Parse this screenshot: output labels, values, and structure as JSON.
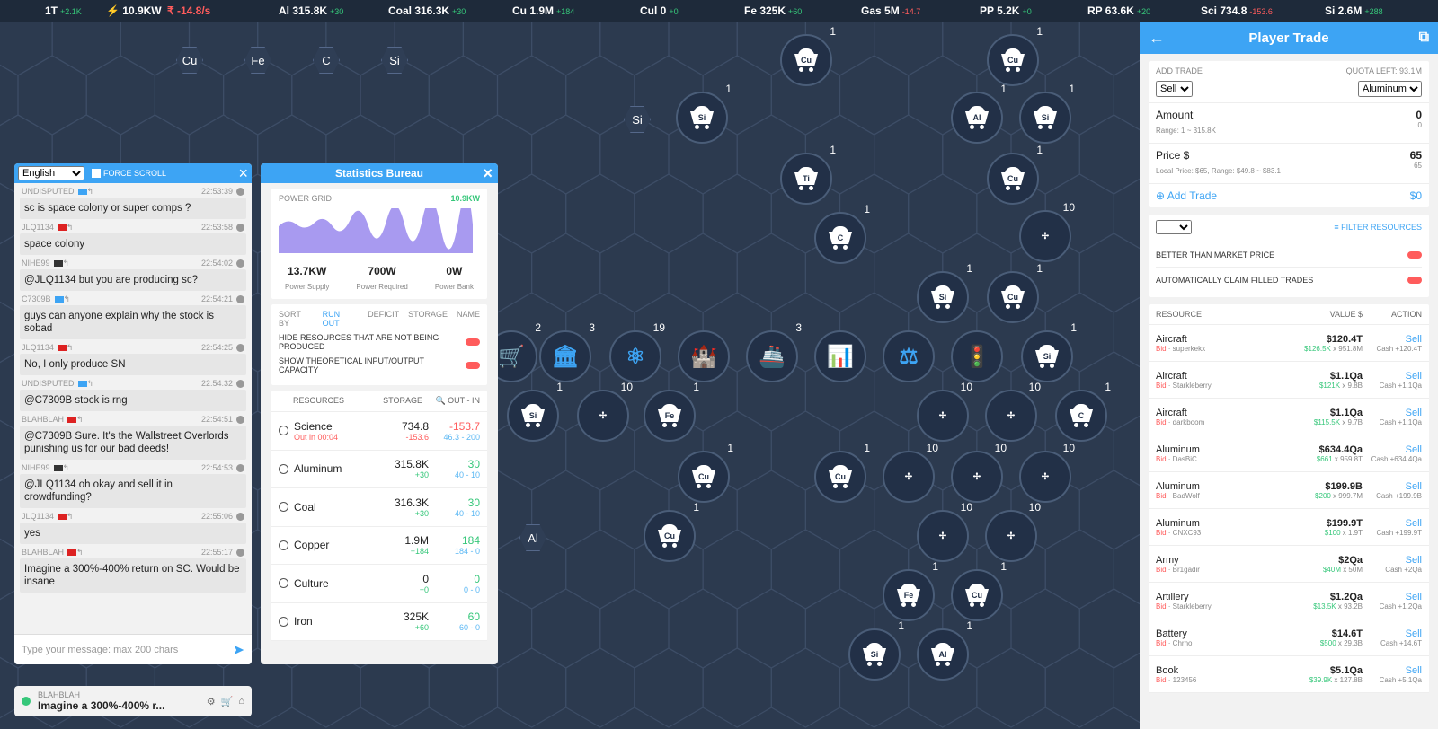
{
  "topbar": [
    {
      "label": "1T",
      "delta": "+2.1K",
      "cls": "up"
    },
    {
      "label": "⚡ 10.9KW",
      "delta": "",
      "cls": "up"
    },
    {
      "label": "₹ -14.8/s",
      "delta": "",
      "cls": "dn"
    },
    {
      "label": "Al 315.8K",
      "delta": "+30",
      "cls": "up"
    },
    {
      "label": "Coal 316.3K",
      "delta": "+30",
      "cls": "up"
    },
    {
      "label": "Cu 1.9M",
      "delta": "+184",
      "cls": "up"
    },
    {
      "label": "Cul 0",
      "delta": "+0",
      "cls": "zr"
    },
    {
      "label": "Fe 325K",
      "delta": "+60",
      "cls": "up"
    },
    {
      "label": "Gas 5M",
      "delta": "-14.7",
      "cls": "dn"
    },
    {
      "label": "PP 5.2K",
      "delta": "+0",
      "cls": "zr"
    },
    {
      "label": "RP 63.6K",
      "delta": "+20",
      "cls": "up"
    },
    {
      "label": "Sci 734.8",
      "delta": "-153.6",
      "cls": "dn"
    },
    {
      "label": "Si 2.6M",
      "delta": "+288",
      "cls": "up"
    }
  ],
  "map": {
    "hexlabels": [
      "Cu",
      "Fe",
      "C",
      "Si",
      "Si",
      "Al"
    ],
    "tiles": [
      {
        "t": "Cu",
        "lvl": "1"
      },
      {
        "t": "Cu",
        "lvl": "1"
      },
      {
        "t": "Si",
        "lvl": "1"
      },
      {
        "t": "Al",
        "lvl": "1"
      },
      {
        "t": "Si",
        "lvl": "1"
      },
      {
        "t": "Ti",
        "lvl": "1"
      },
      {
        "t": "Cu",
        "lvl": "1"
      },
      {
        "t": "C",
        "lvl": "1"
      },
      {
        "t": "Si",
        "lvl": "1"
      },
      {
        "t": "Cu",
        "lvl": "1"
      },
      {
        "t": "Si",
        "lvl": "1"
      },
      {
        "t": "Si",
        "lvl": "1"
      },
      {
        "t": "Fe",
        "lvl": "1"
      },
      {
        "t": "Cu",
        "lvl": "1"
      },
      {
        "t": "Cu",
        "lvl": "1"
      },
      {
        "t": "Cu",
        "lvl": "1"
      },
      {
        "t": "Fe",
        "lvl": "1"
      },
      {
        "t": "Cu",
        "lvl": "1"
      },
      {
        "t": "Si",
        "lvl": "1"
      },
      {
        "t": "Al",
        "lvl": "1"
      },
      {
        "t": "C",
        "lvl": "1"
      }
    ],
    "buildings": [
      {
        "icon": "🛒",
        "lvl": "2"
      },
      {
        "icon": "🏛",
        "lvl": "3"
      },
      {
        "icon": "⚛",
        "lvl": "19"
      },
      {
        "icon": "🏰",
        "lvl": ""
      },
      {
        "icon": "🚢",
        "lvl": "3"
      },
      {
        "icon": "📊",
        "lvl": ""
      },
      {
        "icon": "⚖",
        "lvl": ""
      },
      {
        "icon": "🚦",
        "lvl": ""
      }
    ],
    "turbines": [
      "10",
      "10",
      "10",
      "10",
      "10",
      "10",
      "10",
      "10",
      "10"
    ]
  },
  "chat": {
    "language": "English",
    "force_scroll": "FORCE SCROLL",
    "messages": [
      {
        "user": "UNDISPUTED",
        "time": "22:53:39",
        "text": "sc is space colony or super comps ?"
      },
      {
        "user": "JLQ1134",
        "time": "22:53:58",
        "text": "space colony"
      },
      {
        "user": "NIHE99",
        "time": "22:54:02",
        "text": "@JLQ1134 but you are producing sc?"
      },
      {
        "user": "C7309B",
        "time": "22:54:21",
        "text": "guys can anyone explain why the stock is sobad"
      },
      {
        "user": "JLQ1134",
        "time": "22:54:25",
        "text": "No, I only produce SN"
      },
      {
        "user": "UNDISPUTED",
        "time": "22:54:32",
        "text": "@C7309B stock is rng"
      },
      {
        "user": "BLAHBLAH",
        "time": "22:54:51",
        "text": "@C7309B Sure. It's the Wallstreet Overlords punishing us for our bad deeds!"
      },
      {
        "user": "NIHE99",
        "time": "22:54:53",
        "text": "@JLQ1134 oh okay and sell it in crowdfunding?"
      },
      {
        "user": "JLQ1134",
        "time": "22:55:06",
        "text": "yes"
      },
      {
        "user": "BLAHBLAH",
        "time": "22:55:17",
        "text": "Imagine a 300%-400% return on SC. Would be insane"
      }
    ],
    "placeholder": "Type your message: max 200 chars"
  },
  "notification": {
    "user": "BLAHBLAH",
    "text": "Imagine a 300%-400% r..."
  },
  "stats": {
    "title": "Statistics Bureau",
    "power_grid_label": "POWER GRID",
    "power_grid_value": "10.9KW",
    "supply": "13.7KW",
    "supply_label": "Power Supply",
    "required": "700W",
    "required_label": "Power Required",
    "bank": "0W",
    "bank_label": "Power Bank",
    "sort_by": "SORT BY",
    "sort_options": [
      "RUN OUT",
      "DEFICIT",
      "STORAGE",
      "NAME"
    ],
    "opt_hide": "HIDE RESOURCES THAT ARE NOT BEING PRODUCED",
    "opt_theory": "SHOW THEORETICAL INPUT/OUTPUT CAPACITY",
    "col_resources": "RESOURCES",
    "col_storage": "STORAGE",
    "col_outin": "🔍 OUT - IN",
    "rows": [
      {
        "name": "Science",
        "sub": "Out in 00:04",
        "storage": "734.8",
        "sdelta": "-153.6",
        "scls": "dn",
        "net": "-153.7",
        "ncls": "dn",
        "io": "46.3 - 200"
      },
      {
        "name": "Aluminum",
        "sub": "",
        "storage": "315.8K",
        "sdelta": "+30",
        "scls": "up",
        "net": "30",
        "ncls": "up",
        "io": "40 - 10"
      },
      {
        "name": "Coal",
        "sub": "",
        "storage": "316.3K",
        "sdelta": "+30",
        "scls": "up",
        "net": "30",
        "ncls": "up",
        "io": "40 - 10"
      },
      {
        "name": "Copper",
        "sub": "",
        "storage": "1.9M",
        "sdelta": "+184",
        "scls": "up",
        "net": "184",
        "ncls": "up",
        "io": "184 - 0"
      },
      {
        "name": "Culture",
        "sub": "",
        "storage": "0",
        "sdelta": "+0",
        "scls": "up",
        "net": "0",
        "ncls": "up",
        "io": "0 - 0"
      },
      {
        "name": "Iron",
        "sub": "",
        "storage": "325K",
        "sdelta": "+60",
        "scls": "up",
        "net": "60",
        "ncls": "up",
        "io": "60 - 0"
      }
    ]
  },
  "trade": {
    "title": "Player Trade",
    "add_trade": "ADD TRADE",
    "quota": "QUOTA LEFT: 93.1M",
    "side": "Sell",
    "resource": "Aluminum",
    "amount_label": "Amount",
    "amount_range": "Range: 1 ~ 315.8K",
    "amount_val": "0",
    "amount_sub": "0",
    "price_label": "Price $",
    "price_range": "Local Price: $65, Range: $49.8 ~ $83.1",
    "price_val": "65",
    "price_sub": "65",
    "add_btn": "Add Trade",
    "add_total": "$0",
    "filter": "FILTER RESOURCES",
    "better": "BETTER THAN MARKET PRICE",
    "auto": "AUTOMATICALLY CLAIM FILLED TRADES",
    "col_res": "RESOURCE",
    "col_val": "VALUE $",
    "col_act": "ACTION",
    "rows": [
      {
        "res": "Aircraft",
        "bidder": "superkekx",
        "value": "$120.4T",
        "unit": "$126.5K",
        "qty": "x 951.8M",
        "cash": "Cash +120.4T"
      },
      {
        "res": "Aircraft",
        "bidder": "Starkleberry",
        "value": "$1.1Qa",
        "unit": "$121K",
        "qty": "x 9.8B",
        "cash": "Cash +1.1Qa"
      },
      {
        "res": "Aircraft",
        "bidder": "darkboom",
        "value": "$1.1Qa",
        "unit": "$115.5K",
        "qty": "x 9.7B",
        "cash": "Cash +1.1Qa"
      },
      {
        "res": "Aluminum",
        "bidder": "DasBiC",
        "value": "$634.4Qa",
        "unit": "$661",
        "qty": "x 959.8T",
        "cash": "Cash +634.4Qa"
      },
      {
        "res": "Aluminum",
        "bidder": "BadWolf",
        "value": "$199.9B",
        "unit": "$200",
        "qty": "x 999.7M",
        "cash": "Cash +199.9B"
      },
      {
        "res": "Aluminum",
        "bidder": "CNXC93",
        "value": "$199.9T",
        "unit": "$100",
        "qty": "x 1.9T",
        "cash": "Cash +199.9T"
      },
      {
        "res": "Army",
        "bidder": "Br1gadir",
        "value": "$2Qa",
        "unit": "$40M",
        "qty": "x 50M",
        "cash": "Cash +2Qa"
      },
      {
        "res": "Artillery",
        "bidder": "Starkleberry",
        "value": "$1.2Qa",
        "unit": "$13.5K",
        "qty": "x 93.2B",
        "cash": "Cash +1.2Qa"
      },
      {
        "res": "Battery",
        "bidder": "Chrno",
        "value": "$14.6T",
        "unit": "$500",
        "qty": "x 29.3B",
        "cash": "Cash +14.6T"
      },
      {
        "res": "Book",
        "bidder": "123456",
        "value": "$5.1Qa",
        "unit": "$39.9K",
        "qty": "x 127.8B",
        "cash": "Cash +5.1Qa"
      }
    ],
    "bid_label": "Bid",
    "sell_label": "Sell"
  },
  "colors": {
    "accent": "#3da4f4",
    "up": "#36c77a",
    "down": "#ff5c5c",
    "map_bg": "#2c3a4f"
  }
}
